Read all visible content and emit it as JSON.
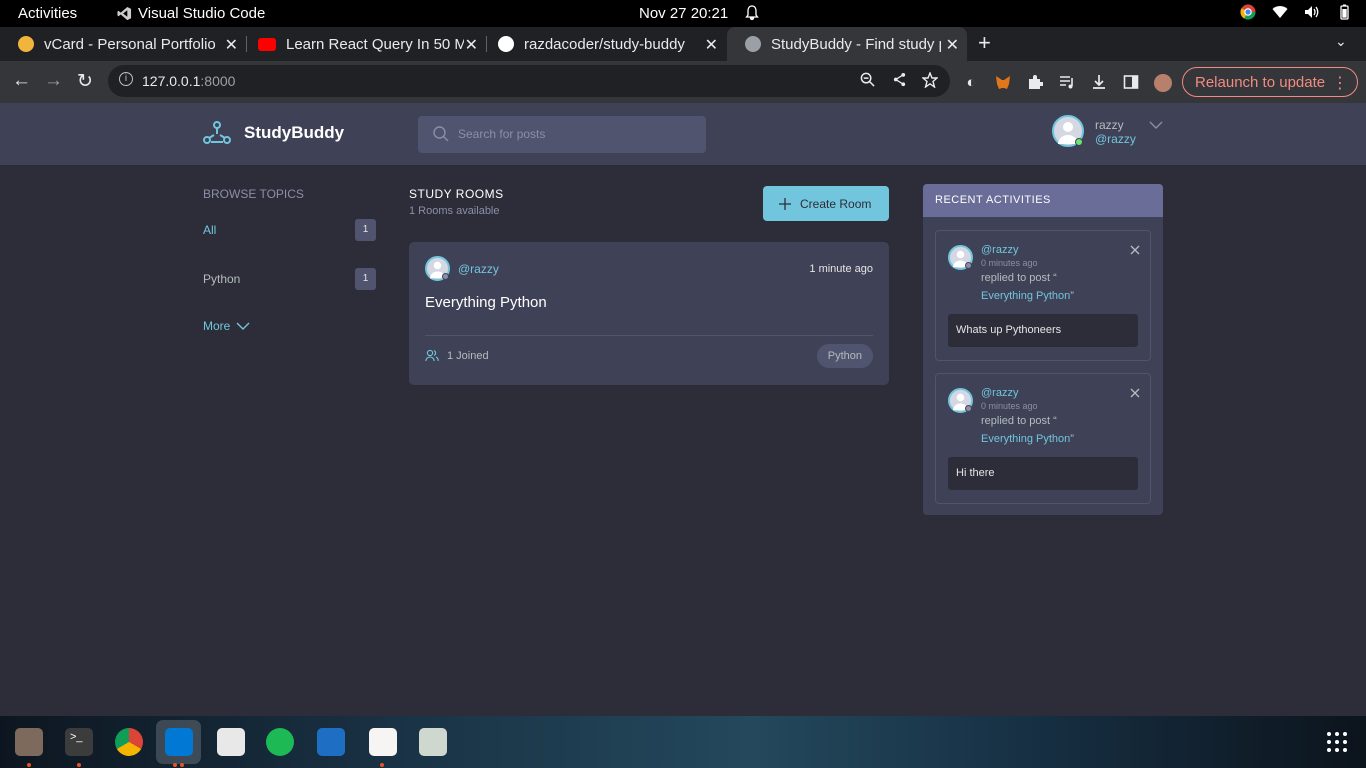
{
  "system": {
    "activities": "Activities",
    "app_name": "Visual Studio Code",
    "clock": "Nov 27  20:21"
  },
  "browser": {
    "tabs": [
      {
        "title": "vCard - Personal Portfolio",
        "favicon_color": "#f1b43c"
      },
      {
        "title": "Learn React Query In 50 M",
        "favicon_color": "#ff0000"
      },
      {
        "title": "razdacoder/study-buddy",
        "favicon_color": "#ffffff"
      },
      {
        "title": "StudyBuddy - Find study p",
        "favicon_color": "#9aa0a6"
      }
    ],
    "url_host": "127.0.0.1",
    "url_port": ":8000",
    "relaunch_label": "Relaunch to update"
  },
  "app": {
    "brand": "StudyBuddy",
    "search_placeholder": "Search for posts",
    "user": {
      "name": "razzy",
      "handle": "@razzy"
    }
  },
  "topics": {
    "heading": "BROWSE TOPICS",
    "items": [
      {
        "name": "All",
        "count": "1"
      },
      {
        "name": "Python",
        "count": "1"
      }
    ],
    "more_label": "More"
  },
  "rooms": {
    "heading": "STUDY ROOMS",
    "subheading": "1 Rooms available",
    "create_label": "Create Room",
    "items": [
      {
        "host": "@razzy",
        "time": "1 minute ago",
        "title": "Everything Python",
        "joined": "1 Joined",
        "topic": "Python"
      }
    ]
  },
  "activities": {
    "heading": "RECENT ACTIVITIES",
    "items": [
      {
        "host": "@razzy",
        "time": "0 minutes ago",
        "action": "replied to post “",
        "room": "Everything Python",
        "close_quote": "”",
        "message": "Whats up Pythoneers"
      },
      {
        "host": "@razzy",
        "time": "0 minutes ago",
        "action": "replied to post “",
        "room": "Everything Python",
        "close_quote": "”",
        "message": "Hi there"
      }
    ]
  },
  "colors": {
    "accent": "#71c6dd",
    "bg": "#2d2d39",
    "panel": "#3f4156",
    "activity_header": "#696d97"
  }
}
